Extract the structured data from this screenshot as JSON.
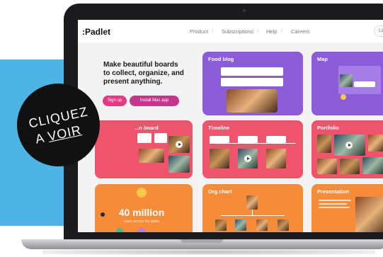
{
  "screen": {
    "logo": ":Padlet",
    "nav": {
      "links": [
        "Product",
        "Subscriptions",
        "Help",
        "Careers"
      ],
      "login_label": "Lo"
    },
    "hero": {
      "headline": "Make beautiful boards to collect, organize, and present anything.",
      "signup_label": "Sign up",
      "install_label": "Install Mac app"
    },
    "cards": {
      "food_blog": "Food blog",
      "map": "Map",
      "mood_board": "...n board",
      "timeline": "Timeline",
      "portfolio": "Portfolio",
      "org_chart": "Org chart",
      "presentation": "Presentation"
    },
    "stats": {
      "count": "40 million",
      "caption": "users across the globe"
    }
  },
  "badge": {
    "line1": "CLIQUEZ",
    "line2_prefix": "A ",
    "line2_link": "VOIR"
  },
  "colors": {
    "accent_pink": "#e33a85",
    "card_purple": "#8b5bd8",
    "card_pink": "#f0546c",
    "card_orange": "#f68c3a",
    "backdrop_blue": "#4db4e4"
  }
}
